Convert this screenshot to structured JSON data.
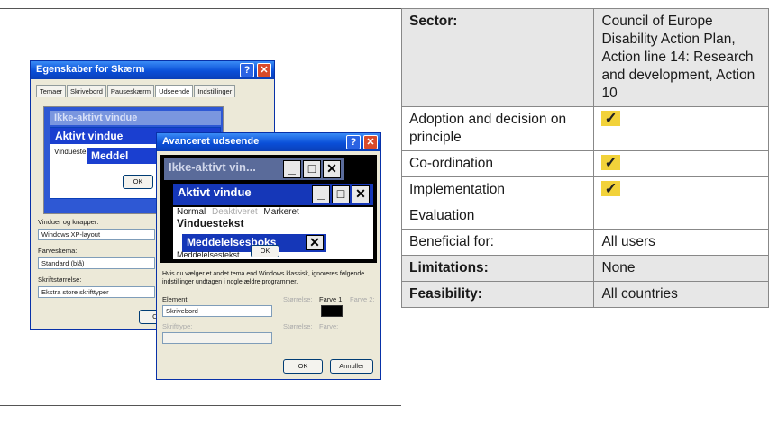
{
  "table": {
    "rows": [
      {
        "key": "Sector:",
        "value": "Council of Europe Disability Action Plan, Action line 14: Research and development, Action 10"
      },
      {
        "key": "Adoption and decision on principle",
        "value": "✓"
      },
      {
        "key": "Co-ordination",
        "value": "✓"
      },
      {
        "key": "Implementation",
        "value": "✓"
      },
      {
        "key": "Evaluation",
        "value": ""
      },
      {
        "key": "Beneficial for:",
        "value": "All users"
      },
      {
        "key": "Limitations:",
        "value": "None"
      },
      {
        "key": "Feasibility:",
        "value": "All countries"
      }
    ]
  },
  "shot": {
    "display_props": {
      "title": "Egenskaber for Skærm",
      "tabs": [
        "Temaer",
        "Skrivebord",
        "Pauseskærm",
        "Udseende",
        "Indstillinger"
      ],
      "inactive_window": "Ikke-aktivt vindue",
      "active_window": "Aktivt vindue",
      "window_text": "Vinduestekst",
      "message_partial": "Meddel",
      "ok_partial": "OK",
      "windows_buttons_label": "Vinduer og knapper:",
      "windows_buttons_value": "Windows XP-layout",
      "color_scheme_label": "Farveskema:",
      "color_scheme_value": "Standard (blå)",
      "font_size_label": "Skriftstørrelse:",
      "font_size_value": "Ekstra store skrifttyper",
      "bottom_button_partial": "O"
    },
    "advanced": {
      "title": "Avanceret udseende",
      "inactive": "Ikke-aktivt vin...",
      "active": "Aktivt vindue",
      "menu": [
        "Normal",
        "Deaktiveret",
        "Markeret"
      ],
      "window_text": "Vinduestekst",
      "message_box": "Meddelelsesboks",
      "message_text": "Meddelelsestekst",
      "ok": "OK",
      "info": "Hvis du vælger et andet tema end Windows klassisk, ignoreres følgende indstillinger undtagen i nogle ældre programmer.",
      "element_label": "Element:",
      "element_value": "Skrivebord",
      "size_label": "Størrelse:",
      "color1_label": "Farve 1:",
      "color2_label": "Farve 2:",
      "font_label": "Skrifttype:",
      "size2_label": "Størrelse:",
      "color_label": "Farve:",
      "ok_button": "OK",
      "cancel_button": "Annuller"
    }
  }
}
